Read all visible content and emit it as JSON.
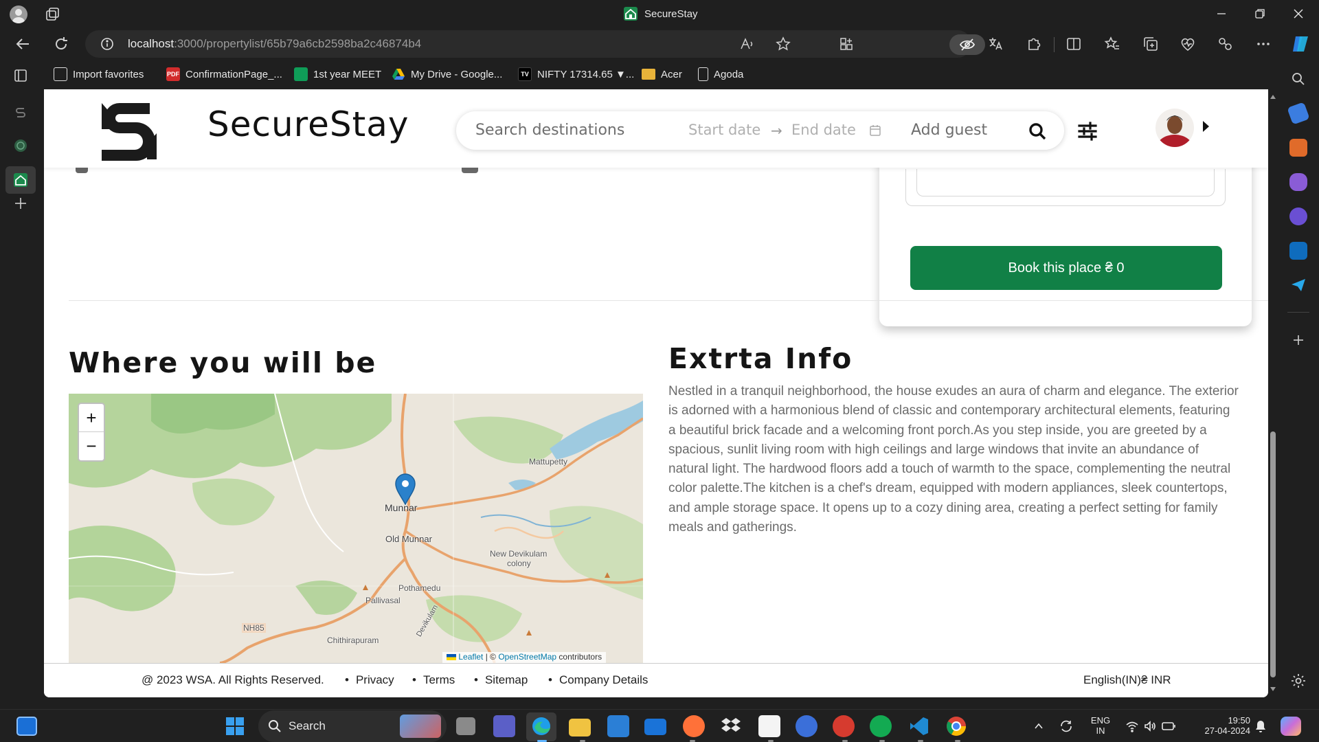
{
  "window": {
    "title": "SecureStay"
  },
  "browser": {
    "url_host": "localhost",
    "url_rest": ":3000/propertylist/65b79a6cb2598ba2c46874b4",
    "favorites": [
      {
        "label": "Import favorites",
        "icon": "import-favorites-icon"
      },
      {
        "label": "ConfirmationPage_...",
        "icon": "pdf-icon"
      },
      {
        "label": "1st year MEET",
        "icon": "meet-icon"
      },
      {
        "label": "My Drive - Google...",
        "icon": "google-drive-icon"
      },
      {
        "label": "NIFTY 17314.65 ▼...",
        "icon": "tradingview-icon"
      },
      {
        "label": "Acer",
        "icon": "folder-icon"
      },
      {
        "label": "Agoda",
        "icon": "page-icon"
      }
    ]
  },
  "site": {
    "brand": "SecureStay",
    "search": {
      "destination_placeholder": "Search destinations",
      "start_date_placeholder": "Start date",
      "arrow": "→",
      "end_date_placeholder": "End date",
      "guest_placeholder": "Add guest"
    }
  },
  "booking": {
    "button_label": "Book this place ₴ 0"
  },
  "location": {
    "title": "Where you will be",
    "map": {
      "zoom_in": "+",
      "zoom_out": "−",
      "labels": [
        "Munnar",
        "Old Munnar",
        "Mattupetty",
        "New Devikulam",
        "colony",
        "Pothamedu",
        "Pallivasal",
        "NH85",
        "Chithirapuram",
        "Devikulam"
      ],
      "attribution_leaflet": "Leaflet",
      "attribution_sep": " | © ",
      "attribution_osm": "OpenStreetMap",
      "attribution_tail": " contributors"
    }
  },
  "extra": {
    "title": "Extrta Info",
    "text": "Nestled in a tranquil neighborhood, the house exudes an aura of charm and elegance. The exterior is adorned with a harmonious blend of classic and contemporary architectural elements, featuring a beautiful brick facade and a welcoming front porch.As you step inside, you are greeted by a spacious, sunlit living room with high ceilings and large windows that invite an abundance of natural light. The hardwood floors add a touch of warmth to the space, complementing the neutral color palette.The kitchen is a chef's dream, equipped with modern appliances, sleek countertops, and ample storage space. It opens up to a cozy dining area, creating a perfect setting for family meals and gatherings."
  },
  "footer": {
    "copyright": "@ 2023 WSA. All Rights Reserved.",
    "links": [
      "Privacy",
      "Terms",
      "Sitemap",
      "Company Details"
    ],
    "locale": "English(IN)₴ INR"
  },
  "taskbar": {
    "search_label": "Search",
    "lang_line1": "ENG",
    "lang_line2": "IN",
    "time": "19:50",
    "date": "27-04-2024"
  },
  "colors": {
    "book_button": "#118046",
    "browser_chrome": "#1f1f1f",
    "taskbar": "#202020"
  }
}
